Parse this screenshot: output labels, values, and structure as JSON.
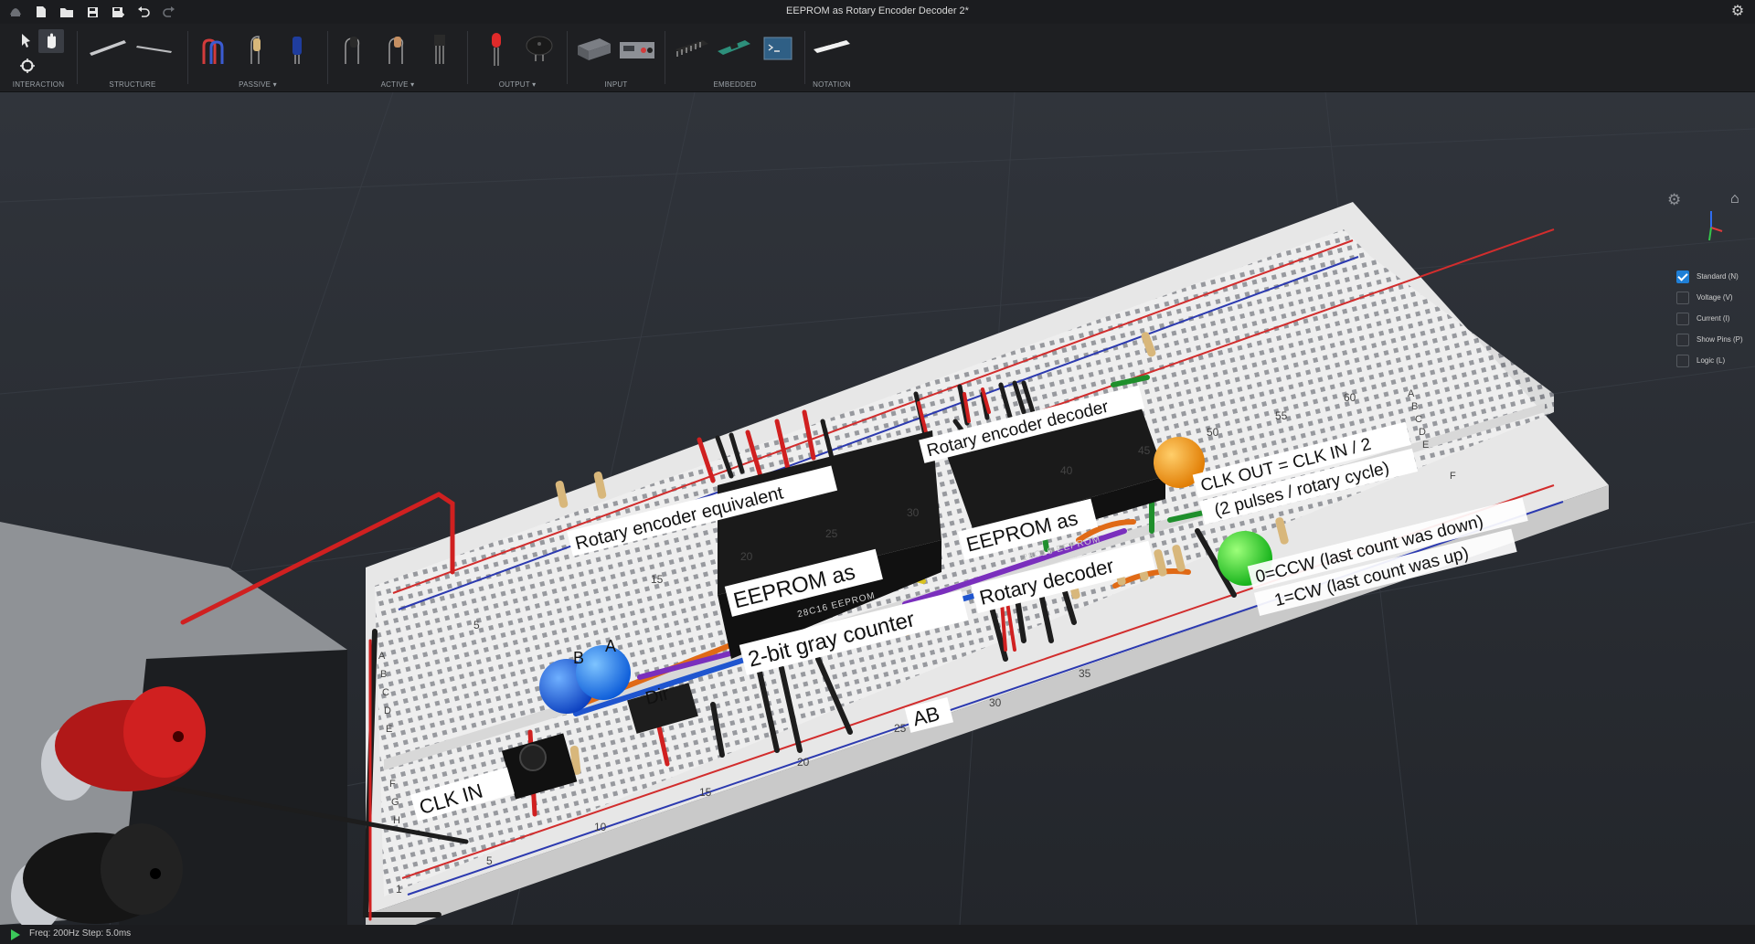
{
  "app": {
    "title": "EEPROM as Rotary Encoder Decoder 2*"
  },
  "toolbar": {
    "groups": [
      {
        "label": "INTERACTION"
      },
      {
        "label": "STRUCTURE"
      },
      {
        "label": "PASSIVE ▾"
      },
      {
        "label": "ACTIVE ▾"
      },
      {
        "label": "OUTPUT ▾"
      },
      {
        "label": "INPUT"
      },
      {
        "label": "EMBEDDED"
      },
      {
        "label": "NOTATION"
      }
    ],
    "label_chip": "LABEL"
  },
  "view_options": [
    {
      "label": "Standard (N)",
      "checked": true
    },
    {
      "label": "Voltage (V)",
      "checked": false
    },
    {
      "label": "Current (I)",
      "checked": false
    },
    {
      "label": "Show Pins (P)",
      "checked": false
    },
    {
      "label": "Logic (L)",
      "checked": false
    }
  ],
  "board": {
    "label_encoder_equiv": "Rotary encoder equivalent",
    "label_decoder": "Rotary encoder decoder",
    "chip1_line1": "EEPROM as",
    "chip1_line2": "2-bit gray counter",
    "chip1_part": "28C16 EEPROM",
    "chip2_line1": "EEPROM as",
    "chip2_line2": "Rotary decoder",
    "chip2_part": "28C16 EEPROM",
    "clk_in": "CLK IN",
    "dir": "Dir",
    "ab": "AB",
    "led_b": "B",
    "led_a": "A",
    "clk_out_1": "CLK OUT = CLK IN / 2",
    "clk_out_2": "(2 pulses / rotary cycle)",
    "ccw": "0=CCW (last count was down)",
    "cw": "1=CW (last count was up)",
    "rows_left": [
      "A",
      "B",
      "C",
      "D",
      "E",
      "F",
      "G",
      "H"
    ],
    "rows_right": [
      "A",
      "B",
      "C",
      "D",
      "E",
      "F"
    ],
    "cols_lower": [
      "1",
      "5",
      "10",
      "15",
      "20",
      "25",
      "30",
      "35"
    ],
    "cols_upper": [
      "5",
      "15",
      "20",
      "25",
      "30",
      "40",
      "45",
      "50",
      "55",
      "60"
    ]
  },
  "status": {
    "text": "Freq: 200Hz  Step: 5.0ms"
  },
  "colors": {
    "accent": "#1f7fd6",
    "play": "#3cc85a",
    "board": "#ebebeb"
  }
}
